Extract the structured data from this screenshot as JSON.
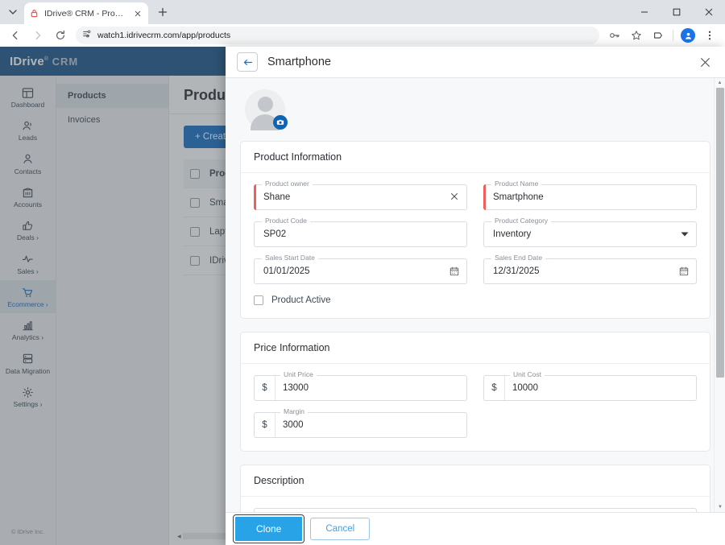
{
  "browser": {
    "tab": {
      "title": "IDrive® CRM - Products",
      "favicon": "lock-icon"
    },
    "new_tab_label": "+",
    "address": "watch1.idrivecrm.com/app/products",
    "icons": {
      "back": "back-arrow-icon",
      "forward": "forward-arrow-icon",
      "reload": "reload-icon",
      "site_info": "site-settings-icon",
      "password": "key-icon",
      "bookmark": "star-icon",
      "extensions": "extensions-icon",
      "profile": "profile-avatar-icon",
      "menu": "three-dot-menu-icon"
    },
    "window": {
      "minimize": "−",
      "maximize": "▫",
      "close": "✕"
    }
  },
  "crm": {
    "logo": {
      "primary": "IDriv",
      "mark": "e",
      "registered": "®",
      "secondary": "CRM"
    },
    "sidebar": {
      "items": [
        {
          "label": "Dashboard",
          "icon": "dashboard-icon",
          "active": false
        },
        {
          "label": "Leads",
          "icon": "leads-icon",
          "active": false
        },
        {
          "label": "Contacts",
          "icon": "contacts-icon",
          "active": false
        },
        {
          "label": "Accounts",
          "icon": "accounts-icon",
          "active": false
        },
        {
          "label": "Deals ›",
          "icon": "deals-thumbsup-icon",
          "active": false
        },
        {
          "label": "Sales ›",
          "icon": "sales-pulse-icon",
          "active": false
        },
        {
          "label": "Ecommerce ›",
          "icon": "ecommerce-cart-icon",
          "active": true
        },
        {
          "label": "Analytics ›",
          "icon": "analytics-chart-icon",
          "active": false
        },
        {
          "label": "Data Migration",
          "icon": "data-migration-icon",
          "active": false
        },
        {
          "label": "Settings ›",
          "icon": "settings-gear-icon",
          "active": false
        }
      ],
      "footer": "© IDrive Inc."
    },
    "subnav": [
      {
        "label": "Products",
        "active": true
      },
      {
        "label": "Invoices",
        "active": false
      }
    ],
    "page_title": "Products",
    "create_button": "+ Create P",
    "table": {
      "header": "Produ",
      "rows": [
        "Smar",
        "Lapto",
        "IDriv"
      ]
    }
  },
  "modal": {
    "title": "Smartphone",
    "back_icon": "back-arrow-icon",
    "close_icon": "close-icon",
    "avatar": {
      "name": "avatar-placeholder",
      "badge_icon": "camera-icon"
    },
    "sections": {
      "product_information": {
        "heading": "Product Information",
        "fields": {
          "product_owner": {
            "label": "Product owner",
            "value": "Shane",
            "required": true,
            "clear_icon": "clear-x-icon"
          },
          "product_name": {
            "label": "Product Name",
            "value": "Smartphone",
            "required": true
          },
          "product_code": {
            "label": "Product Code",
            "value": "SP02",
            "required": false
          },
          "product_category": {
            "label": "Product Category",
            "value": "Inventory",
            "required": false,
            "icon": "chevron-down-icon"
          },
          "sales_start_date": {
            "label": "Sales Start Date",
            "value": "01/01/2025",
            "icon": "calendar-icon"
          },
          "sales_end_date": {
            "label": "Sales End Date",
            "value": "12/31/2025",
            "icon": "calendar-icon"
          }
        },
        "checkbox": {
          "label": "Product Active",
          "checked": false
        }
      },
      "price_information": {
        "heading": "Price Information",
        "currency_symbol": "$",
        "fields": {
          "unit_price": {
            "label": "Unit Price",
            "value": "13000"
          },
          "unit_cost": {
            "label": "Unit Cost",
            "value": "10000"
          },
          "margin": {
            "label": "Margin",
            "value": "3000"
          }
        }
      },
      "description": {
        "heading": "Description",
        "value": ""
      }
    },
    "footer": {
      "primary": "Clone",
      "secondary": "Cancel"
    }
  }
}
